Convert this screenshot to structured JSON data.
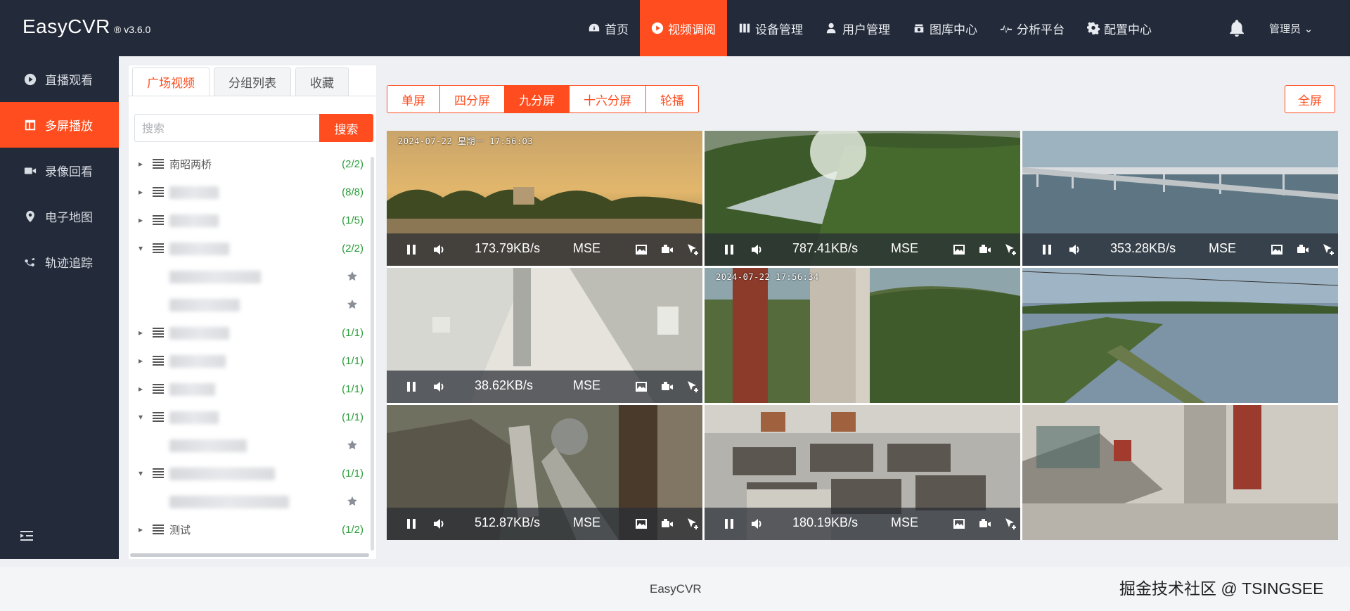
{
  "app": {
    "name": "EasyCVR",
    "version": "® v3.6.0"
  },
  "nav": [
    {
      "label": "首页",
      "icon": "dashboard-icon"
    },
    {
      "label": "视频调阅",
      "icon": "play-circle-icon",
      "active": true
    },
    {
      "label": "设备管理",
      "icon": "device-icon"
    },
    {
      "label": "用户管理",
      "icon": "user-icon"
    },
    {
      "label": "图库中心",
      "icon": "gallery-icon"
    },
    {
      "label": "分析平台",
      "icon": "pulse-icon"
    },
    {
      "label": "配置中心",
      "icon": "gear-icon"
    }
  ],
  "user": {
    "label": "管理员 ⌄"
  },
  "sidebar": [
    {
      "label": "直播观看",
      "icon": "play-icon"
    },
    {
      "label": "多屏播放",
      "icon": "layout-icon",
      "active": true
    },
    {
      "label": "录像回看",
      "icon": "camera-icon"
    },
    {
      "label": "电子地图",
      "icon": "map-pin-icon"
    },
    {
      "label": "轨迹追踪",
      "icon": "track-icon"
    }
  ],
  "panel": {
    "tabs": [
      "广场视频",
      "分组列表",
      "收藏"
    ],
    "search_placeholder": "搜索",
    "search_button": "搜索",
    "tree": [
      {
        "name": "南昭两桥",
        "count": "(2/2)",
        "arrow": "▸"
      },
      {
        "name": "",
        "count": "(8/8)",
        "arrow": "▸"
      },
      {
        "name": "",
        "count": "(1/5)",
        "arrow": "▸"
      },
      {
        "name": "",
        "count": "(2/2)",
        "arrow": "▾"
      },
      {
        "name": "",
        "count": "",
        "arrow": "",
        "star": true
      },
      {
        "name": "",
        "count": "",
        "arrow": "",
        "star": true
      },
      {
        "name": "",
        "count": "(1/1)",
        "arrow": "▸"
      },
      {
        "name": "",
        "count": "(1/1)",
        "arrow": "▸"
      },
      {
        "name": "",
        "count": "(1/1)",
        "arrow": "▸"
      },
      {
        "name": "",
        "count": "(1/1)",
        "arrow": "▾"
      },
      {
        "name": "",
        "count": "",
        "arrow": "",
        "star": true
      },
      {
        "name": "",
        "count": "(1/1)",
        "arrow": "▾"
      },
      {
        "name": "",
        "count": "",
        "arrow": "",
        "star": true
      },
      {
        "name": "测试",
        "count": "(1/2)",
        "arrow": "▸"
      }
    ]
  },
  "layouts": [
    {
      "label": "单屏"
    },
    {
      "label": "四分屏"
    },
    {
      "label": "九分屏",
      "active": true
    },
    {
      "label": "十六分屏"
    },
    {
      "label": "轮播"
    }
  ],
  "fullscreen": "全屏",
  "videos": [
    {
      "osd": "2024-07-22  星期一  17:56:03",
      "rate": "173.79KB/s",
      "mode": "MSE",
      "scene": "lake-sunset"
    },
    {
      "osd": "",
      "rate": "787.41KB/s",
      "mode": "MSE",
      "scene": "forest-valley"
    },
    {
      "osd": "",
      "rate": "353.28KB/s",
      "mode": "MSE",
      "scene": "bridge-sea"
    },
    {
      "osd": "",
      "rate": "38.62KB/s",
      "mode": "MSE",
      "scene": "alley"
    },
    {
      "osd": "2024-07-22 17:56:34",
      "rate": "",
      "mode": "",
      "scene": "pillar-hill"
    },
    {
      "osd": "",
      "rate": "",
      "mode": "",
      "scene": "ponds"
    },
    {
      "osd": "",
      "rate": "512.87KB/s",
      "mode": "MSE",
      "scene": "rocks-pipe"
    },
    {
      "osd": "",
      "rate": "180.19KB/s",
      "mode": "MSE",
      "scene": "classroom"
    },
    {
      "osd": "",
      "rate": "",
      "mode": "",
      "scene": "stairwell"
    }
  ],
  "footer": {
    "text": "EasyCVR",
    "credit": "掘金技术社区 @ TSINGSEE"
  },
  "colors": {
    "accent": "#ff4d1f",
    "dark": "#232a39",
    "count_green": "#2a9d3a"
  }
}
